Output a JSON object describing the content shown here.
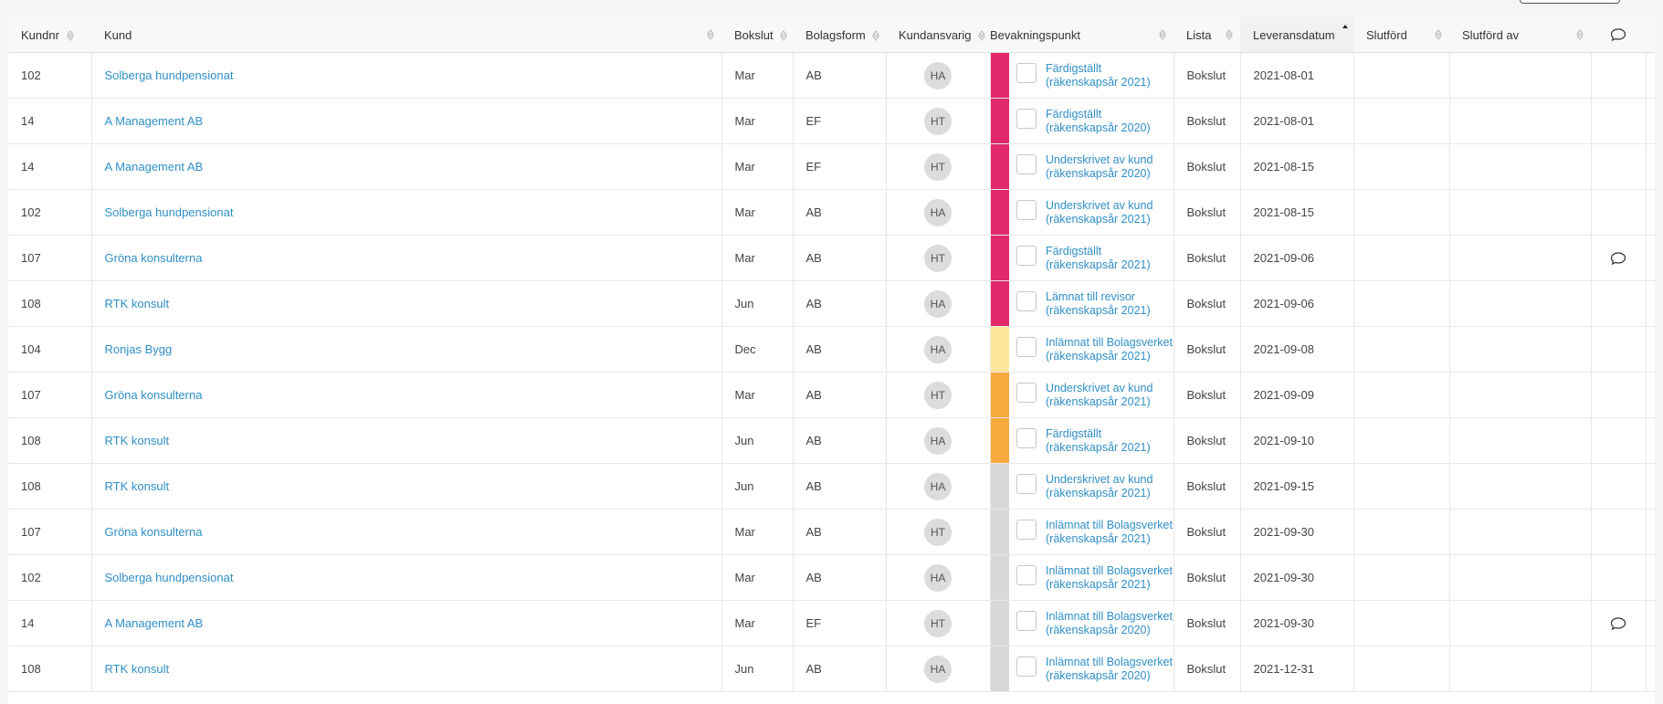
{
  "columns": {
    "kundnr": "Kundnr",
    "kund": "Kund",
    "bokslut": "Bokslut",
    "bolagsform": "Bolagsform",
    "kundansvarig": "Kundansvarig",
    "bevakningspunkt": "Bevakningspunkt",
    "lista": "Lista",
    "leveransdatum": "Leveransdatum",
    "slutford": "Slutförd",
    "slutford_av": "Slutförd av",
    "comments_icon": "speech-bubble-icon"
  },
  "sort": {
    "column": "leveransdatum",
    "direction": "ascending"
  },
  "colors": {
    "overdue": "#e0286a",
    "near": "#fde59c",
    "soon": "#f8a93c",
    "future": "#d8d8d8",
    "link": "#2f8fc7"
  },
  "rows": [
    {
      "kundnr": "102",
      "kund": "Solberga hundpension­at",
      "bokslut": "Mar",
      "bolagsform": "AB",
      "kundansvarig": "HA",
      "status": "overdue",
      "bevakningspunkt": "Färdigställt (räkenskapsår 2021)",
      "lista": "Bokslut",
      "leveransdatum": "2021-08-01",
      "slutford": "",
      "slutford_av": "",
      "has_comment": false
    },
    {
      "kundnr": "14",
      "kund": "A Management AB",
      "bokslut": "Mar",
      "bolagsform": "EF",
      "kundansvarig": "HT",
      "status": "overdue",
      "bevakningspunkt": "Färdigställt (räkenskapsår 2020)",
      "lista": "Bokslut",
      "leveransdatum": "2021-08-01",
      "slutford": "",
      "slutford_av": "",
      "has_comment": false
    },
    {
      "kundnr": "14",
      "kund": "A Management AB",
      "bokslut": "Mar",
      "bolagsform": "EF",
      "kundansvarig": "HT",
      "status": "overdue",
      "bevakningspunkt": "Underskrivet av kund (räkenskapsår 2020)",
      "lista": "Bokslut",
      "leveransdatum": "2021-08-15",
      "slutford": "",
      "slutford_av": "",
      "has_comment": false
    },
    {
      "kundnr": "102",
      "kund": "Solberga hundpensionat",
      "bokslut": "Mar",
      "bolagsform": "AB",
      "kundansvarig": "HA",
      "status": "overdue",
      "bevakningspunkt": "Underskrivet av kund (räkenskapsår 2021)",
      "lista": "Bokslut",
      "leveransdatum": "2021-08-15",
      "slutford": "",
      "slutford_av": "",
      "has_comment": false
    },
    {
      "kundnr": "107",
      "kund": "Gröna konsulterna",
      "bokslut": "Mar",
      "bolagsform": "AB",
      "kundansvarig": "HT",
      "status": "overdue",
      "bevakningspunkt": "Färdigställt (räkenskapsår 2021)",
      "lista": "Bokslut",
      "leveransdatum": "2021-09-06",
      "slutford": "",
      "slutford_av": "",
      "has_comment": true
    },
    {
      "kundnr": "108",
      "kund": "RTK konsult",
      "bokslut": "Jun",
      "bolagsform": "AB",
      "kundansvarig": "HA",
      "status": "overdue",
      "bevakningspunkt": "Lämnat till revisor (räkenskapsår 2021)",
      "lista": "Bokslut",
      "leveransdatum": "2021-09-06",
      "slutford": "",
      "slutford_av": "",
      "has_comment": false
    },
    {
      "kundnr": "104",
      "kund": "Ronjas Bygg",
      "bokslut": "Dec",
      "bolagsform": "AB",
      "kundansvarig": "HA",
      "status": "near",
      "bevakningspunkt": "Inlämnat till Bolagsverket (räkenskapsår 2021)",
      "lista": "Bokslut",
      "leveransdatum": "2021-09-08",
      "slutford": "",
      "slutford_av": "",
      "has_comment": false
    },
    {
      "kundnr": "107",
      "kund": "Gröna konsulterna",
      "bokslut": "Mar",
      "bolagsform": "AB",
      "kundansvarig": "HT",
      "status": "soon",
      "bevakningspunkt": "Underskrivet av kund (räkenskapsår 2021)",
      "lista": "Bokslut",
      "leveransdatum": "2021-09-09",
      "slutford": "",
      "slutford_av": "",
      "has_comment": false
    },
    {
      "kundnr": "108",
      "kund": "RTK konsult",
      "bokslut": "Jun",
      "bolagsform": "AB",
      "kundansvarig": "HA",
      "status": "soon",
      "bevakningspunkt": "Färdigställt (räkenskapsår 2021)",
      "lista": "Bokslut",
      "leveransdatum": "2021-09-10",
      "slutford": "",
      "slutford_av": "",
      "has_comment": false
    },
    {
      "kundnr": "108",
      "kund": "RTK konsult",
      "bokslut": "Jun",
      "bolagsform": "AB",
      "kundansvarig": "HA",
      "status": "future",
      "bevakningspunkt": "Underskrivet av kund (räkenskapsår 2021)",
      "lista": "Bokslut",
      "leveransdatum": "2021-09-15",
      "slutford": "",
      "slutford_av": "",
      "has_comment": false
    },
    {
      "kundnr": "107",
      "kund": "Gröna konsulterna",
      "bokslut": "Mar",
      "bolagsform": "AB",
      "kundansvarig": "HT",
      "status": "future",
      "bevakningspunkt": "Inlämnat till Bolagsverket (räkenskapsår 2021)",
      "lista": "Bokslut",
      "leveransdatum": "2021-09-30",
      "slutford": "",
      "slutford_av": "",
      "has_comment": false
    },
    {
      "kundnr": "102",
      "kund": "Solberga hundpensionat",
      "bokslut": "Mar",
      "bolagsform": "AB",
      "kundansvarig": "HA",
      "status": "future",
      "bevakningspunkt": "Inlämnat till Bolagsverket (räkenskapsår 2021)",
      "lista": "Bokslut",
      "leveransdatum": "2021-09-30",
      "slutford": "",
      "slutford_av": "",
      "has_comment": false
    },
    {
      "kundnr": "14",
      "kund": "A Management AB",
      "bokslut": "Mar",
      "bolagsform": "EF",
      "kundansvarig": "HT",
      "status": "future",
      "bevakningspunkt": "Inlämnat till Bolagsverket (räkenskapsår 2020)",
      "lista": "Bokslut",
      "leveransdatum": "2021-09-30",
      "slutford": "",
      "slutford_av": "",
      "has_comment": true
    },
    {
      "kundnr": "108",
      "kund": "RTK konsult",
      "bokslut": "Jun",
      "bolagsform": "AB",
      "kundansvarig": "HA",
      "status": "future",
      "bevakningspunkt": "Inlämnat till Bolagsverket (räkenskapsår 2020)",
      "lista": "Bokslut",
      "leveransdatum": "2021-12-31",
      "slutford": "",
      "slutford_av": "",
      "has_comment": false
    }
  ]
}
